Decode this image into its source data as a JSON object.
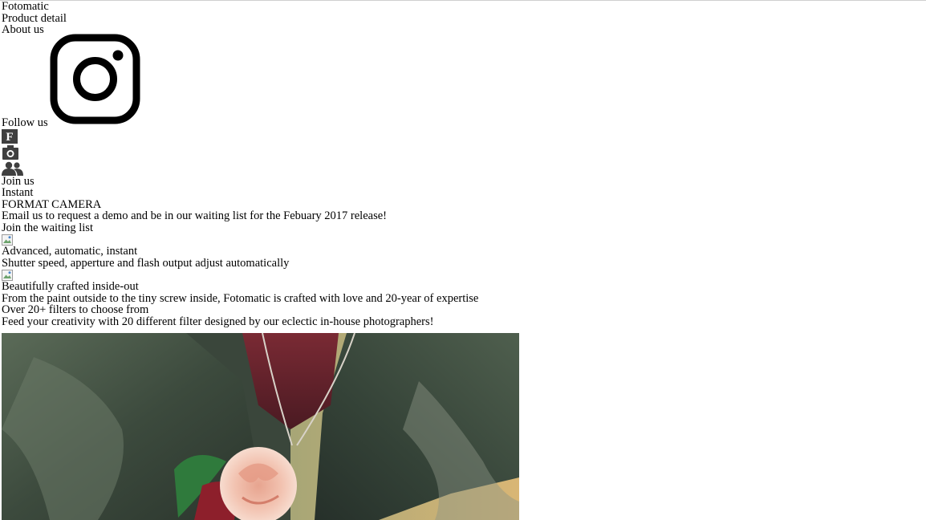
{
  "header": {
    "brand": "Fotomatic",
    "nav": {
      "product_detail": "Product detail",
      "about_us": "About us"
    },
    "follow_label": "Follow us",
    "social_icons": [
      "instagram-icon",
      "facebook-icon",
      "camera-icon",
      "group-icon"
    ],
    "join_label": "Join us"
  },
  "hero": {
    "title_line1": "Instant",
    "title_line2": "FORMAT CAMERA",
    "description": "Email us to request a demo and be in our waiting list for the Febuary 2017 release!",
    "cta_label": "Join the waiting list"
  },
  "features": [
    {
      "title": "Advanced, automatic, instant",
      "text": "Shutter speed, apperture and flash output adjust automatically"
    },
    {
      "title": "Beautifully crafted inside-out",
      "text": "From the paint outside to the tiny screw inside, Fotomatic is crafted with love and 20-year of expertise"
    },
    {
      "title": "Over 20+ filters to choose from",
      "text": "Feed your creativity with 20 different filter designed by our eclectic in-house photographers!"
    }
  ]
}
